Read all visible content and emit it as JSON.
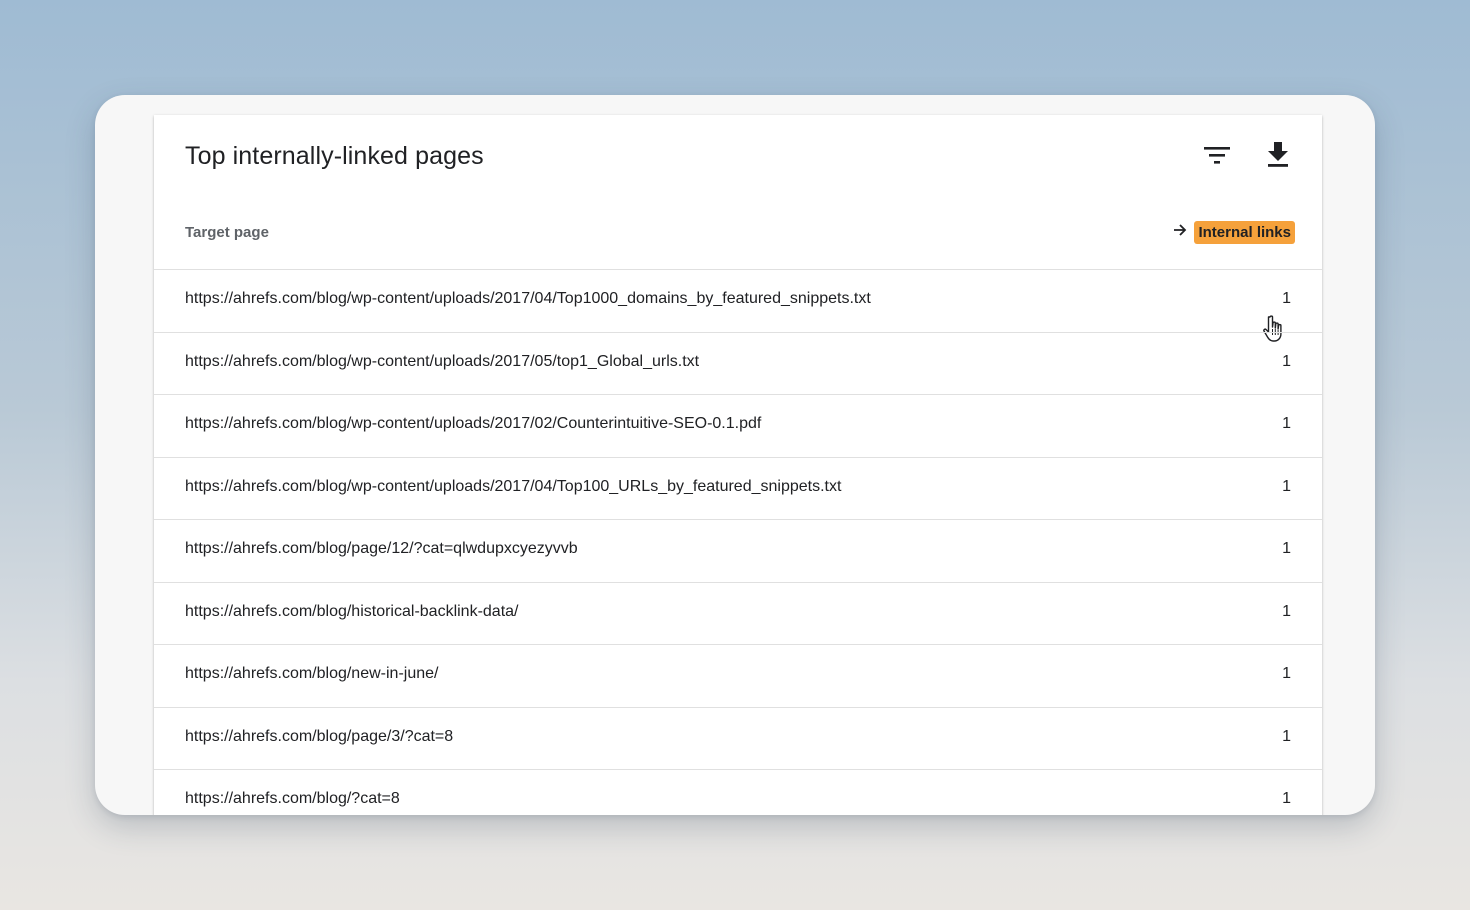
{
  "card": {
    "title": "Top internally-linked pages",
    "icons": {
      "filter": "filter-icon",
      "download": "download-icon"
    }
  },
  "columns": {
    "target": "Target page",
    "links": "Internal links",
    "sort_icon": "arrow-right-icon",
    "highlight_color": "#f5a13b"
  },
  "rows": [
    {
      "url": "https://ahrefs.com/blog/wp-content/uploads/2017/04/Top1000_domains_by_featured_snippets.txt",
      "count": "1"
    },
    {
      "url": "https://ahrefs.com/blog/wp-content/uploads/2017/05/top1_Global_urls.txt",
      "count": "1"
    },
    {
      "url": "https://ahrefs.com/blog/wp-content/uploads/2017/02/Counterintuitive-SEO-0.1.pdf",
      "count": "1"
    },
    {
      "url": "https://ahrefs.com/blog/wp-content/uploads/2017/04/Top100_URLs_by_featured_snippets.txt",
      "count": "1"
    },
    {
      "url": "https://ahrefs.com/blog/page/12/?cat=qlwdupxcyezyvvb",
      "count": "1"
    },
    {
      "url": "https://ahrefs.com/blog/historical-backlink-data/",
      "count": "1"
    },
    {
      "url": "https://ahrefs.com/blog/new-in-june/",
      "count": "1"
    },
    {
      "url": "https://ahrefs.com/blog/page/3/?cat=8",
      "count": "1"
    },
    {
      "url": "https://ahrefs.com/blog/?cat=8",
      "count": "1"
    }
  ]
}
